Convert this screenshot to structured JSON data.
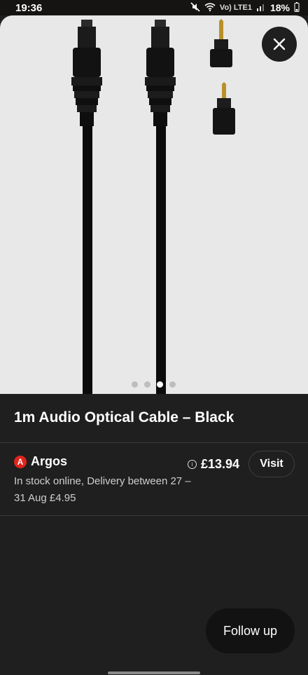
{
  "status": {
    "time": "19:36",
    "network": "Vo) LTE1",
    "battery": "18%"
  },
  "product": {
    "title": "1m Audio Optical Cable – Black",
    "image_dots": 4,
    "active_dot": 2
  },
  "offer": {
    "merchant": "Argos",
    "merchant_logo_letter": "A",
    "merchant_color": "#e1251b",
    "availability": "In stock online, Delivery between 27 – 31 Aug £4.95",
    "price": "£13.94",
    "visit_label": "Visit"
  },
  "actions": {
    "follow_up_label": "Follow up"
  }
}
